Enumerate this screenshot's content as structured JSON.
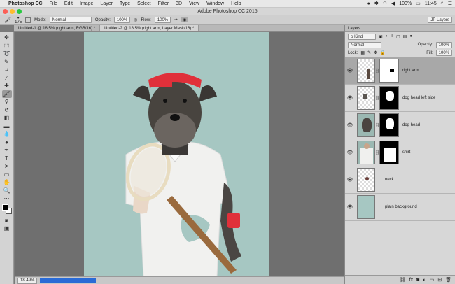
{
  "menubar": {
    "app": "Photoshop CC",
    "items": [
      "File",
      "Edit",
      "Image",
      "Layer",
      "Type",
      "Select",
      "Filter",
      "3D",
      "View",
      "Window",
      "Help"
    ],
    "battery": "100%",
    "time": "11:45"
  },
  "window": {
    "title": "Adobe Photoshop CC 2015"
  },
  "options": {
    "brush_size": "175",
    "mode_label": "Mode:",
    "mode_value": "Normal",
    "opacity_label": "Opacity:",
    "opacity_value": "100%",
    "flow_label": "Flow:",
    "flow_value": "100%",
    "workspace": "JP Layers"
  },
  "tabs": [
    {
      "label": "Untitled-1 @ 18.5% (right arm, RGB/16) *"
    },
    {
      "label": "Untitled-2 @ 18.5% (right arm, Layer Mask/16) *"
    }
  ],
  "status": {
    "zoom": "18.49%"
  },
  "layers_panel": {
    "tab": "Layers",
    "filter": "ρ Kind",
    "blend_mode": "Normal",
    "opacity_label": "Opacity:",
    "opacity_value": "100%",
    "lock_label": "Lock:",
    "fill_label": "Fill:",
    "fill_value": "100%",
    "layers": [
      {
        "name": "right arm",
        "selected": true
      },
      {
        "name": "dog head left side",
        "selected": false
      },
      {
        "name": "dog head",
        "selected": false
      },
      {
        "name": "shirt",
        "selected": false
      },
      {
        "name": "neck",
        "selected": false
      },
      {
        "name": "plain background",
        "selected": false
      }
    ]
  },
  "colors": {
    "canvas_bg": "#a6c7c2",
    "selected_layer": "#a8a8a8",
    "progress": "#2a6bd6"
  }
}
